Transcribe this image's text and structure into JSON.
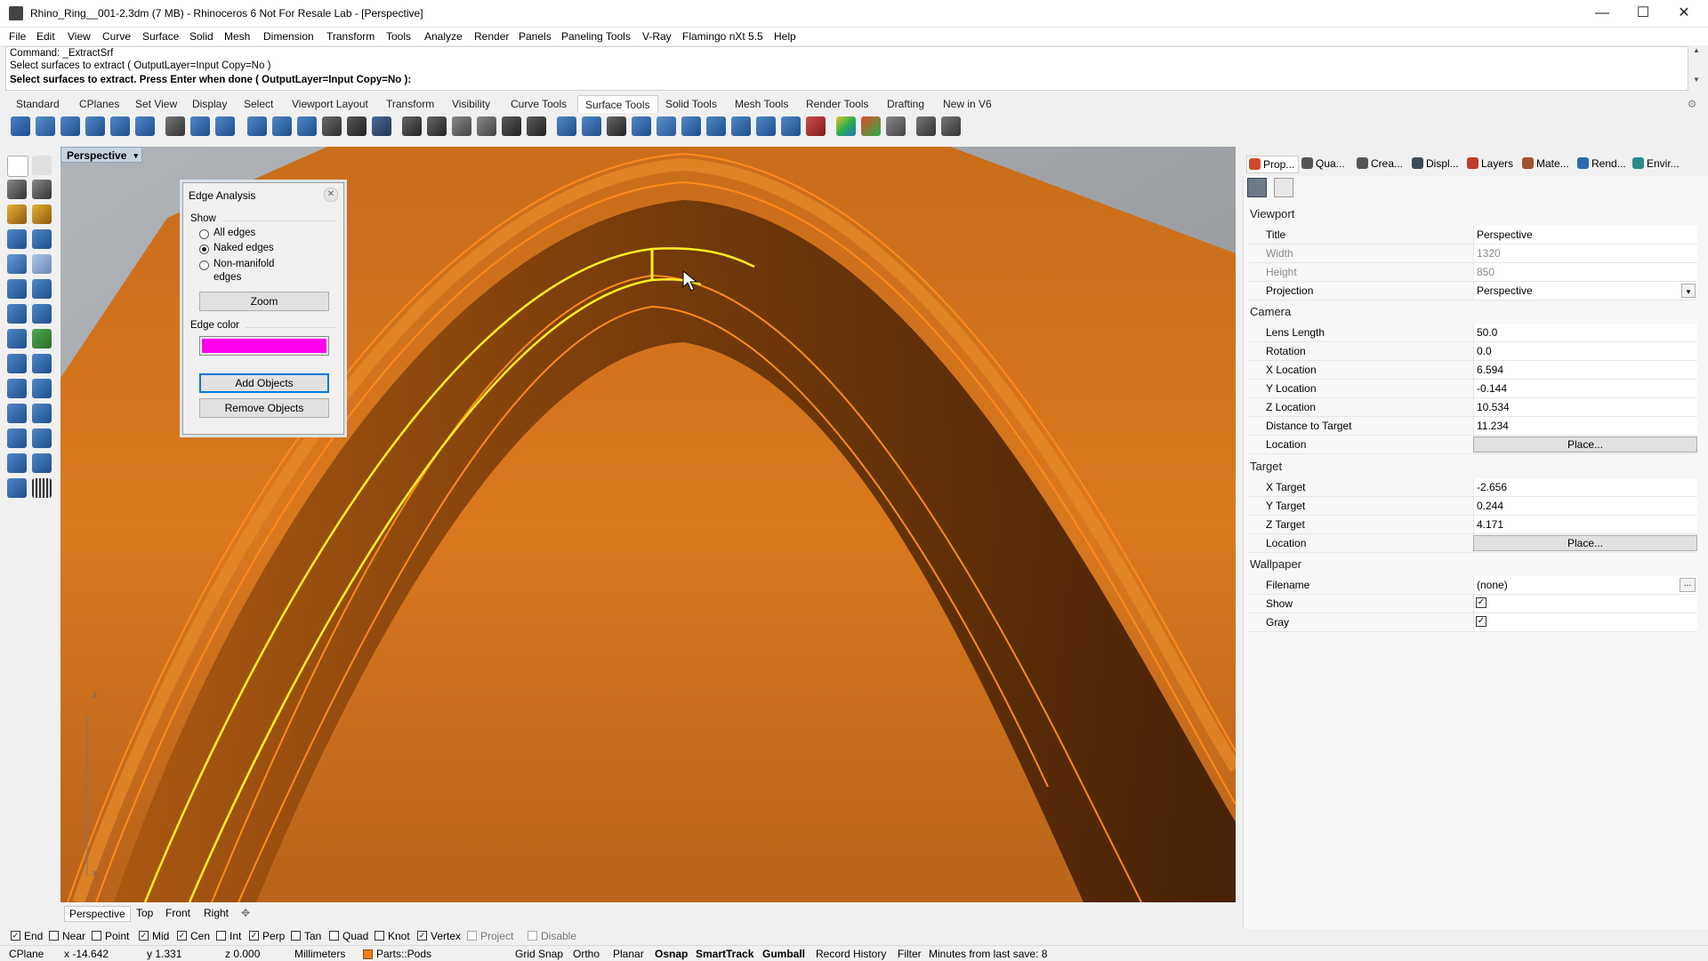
{
  "window": {
    "title": "Rhino_Ring__001-2.3dm (7 MB) - Rhinoceros 6 Not For Resale Lab - [Perspective]",
    "minimize_glyph": "—",
    "maximize_glyph": "☐",
    "close_glyph": "✕"
  },
  "menu": [
    "File",
    "Edit",
    "View",
    "Curve",
    "Surface",
    "Solid",
    "Mesh",
    "Dimension",
    "Transform",
    "Tools",
    "Analyze",
    "Render",
    "Panels",
    "Paneling Tools",
    "V-Ray",
    "Flamingo nXt 5.5",
    "Help"
  ],
  "command": {
    "line1": "Command: _ExtractSrf",
    "line2": "Select surfaces to extract ( OutputLayer=Input  Copy=No )",
    "line3": "Select surfaces to extract. Press Enter when done ( OutputLayer=Input  Copy=No ):"
  },
  "toolbar_tabs": [
    "Standard",
    "CPlanes",
    "Set View",
    "Display",
    "Select",
    "Viewport Layout",
    "Transform",
    "Visibility",
    "Curve Tools",
    "Surface Tools",
    "Solid Tools",
    "Mesh Tools",
    "Render Tools",
    "Drafting",
    "New in V6"
  ],
  "active_toolbar_tab": "Surface Tools",
  "viewport": {
    "title": "Perspective",
    "dropdown_glyph": "▾",
    "tabs": [
      "Perspective",
      "Top",
      "Front",
      "Right"
    ],
    "add_tab_glyph": "✥",
    "axis_z": "z",
    "axis_x": "x"
  },
  "edge_analysis": {
    "title": "Edge Analysis",
    "close_glyph": "✕",
    "show_label": "Show",
    "options": [
      {
        "label": "All edges",
        "selected": false
      },
      {
        "label": "Naked edges",
        "selected": true
      },
      {
        "label": "Non-manifold",
        "label2": "edges",
        "selected": false
      }
    ],
    "zoom_button": "Zoom",
    "edge_color_label": "Edge color",
    "edge_color": "#ff00ee",
    "add_objects_button": "Add Objects",
    "remove_objects_button": "Remove Objects"
  },
  "panel_tabs": [
    {
      "label": "Prop...",
      "color": "#d04a2a"
    },
    {
      "label": "Qua...",
      "color": "#555555"
    },
    {
      "label": "Crea...",
      "color": "#555555"
    },
    {
      "label": "Displ...",
      "color": "#3d4a5a"
    },
    {
      "label": "Layers",
      "color": "#c0392b"
    },
    {
      "label": "Mate...",
      "color": "#a0522d"
    },
    {
      "label": "Rend...",
      "color": "#2a6bb0"
    },
    {
      "label": "Envir...",
      "color": "#2a8a8a"
    }
  ],
  "properties": {
    "viewport_group": "Viewport",
    "title_label": "Title",
    "title_value": "Perspective",
    "width_label": "Width",
    "width_value": "1320",
    "height_label": "Height",
    "height_value": "850",
    "projection_label": "Projection",
    "projection_value": "Perspective",
    "dropdown_glyph": "▾",
    "camera_group": "Camera",
    "lens_label": "Lens Length",
    "lens_value": "50.0",
    "rotation_label": "Rotation",
    "rotation_value": "0.0",
    "xloc_label": "X Location",
    "xloc_value": "6.594",
    "yloc_label": "Y Location",
    "yloc_value": "-0.144",
    "zloc_label": "Z Location",
    "zloc_value": "10.534",
    "dist_label": "Distance to Target",
    "dist_value": "11.234",
    "cam_location_label": "Location",
    "place_button": "Place...",
    "target_group": "Target",
    "xt_label": "X Target",
    "xt_value": "-2.656",
    "yt_label": "Y Target",
    "yt_value": "0.244",
    "zt_label": "Z Target",
    "zt_value": "4.171",
    "tgt_location_label": "Location",
    "wallpaper_group": "Wallpaper",
    "filename_label": "Filename",
    "filename_value": "(none)",
    "browse_glyph": "...",
    "show_label": "Show",
    "show_checked": true,
    "gray_label": "Gray",
    "gray_checked": true,
    "check_glyph": "✓"
  },
  "osnaps": [
    {
      "label": "End",
      "checked": true
    },
    {
      "label": "Near",
      "checked": false
    },
    {
      "label": "Point",
      "checked": false
    },
    {
      "label": "Mid",
      "checked": true
    },
    {
      "label": "Cen",
      "checked": true
    },
    {
      "label": "Int",
      "checked": false
    },
    {
      "label": "Perp",
      "checked": true
    },
    {
      "label": "Tan",
      "checked": false
    },
    {
      "label": "Quad",
      "checked": false
    },
    {
      "label": "Knot",
      "checked": false
    },
    {
      "label": "Vertex",
      "checked": true
    },
    {
      "label": "Project",
      "checked": false,
      "disabled": true
    },
    {
      "label": "Disable",
      "checked": false,
      "disabled": true
    }
  ],
  "status": {
    "cplane": "CPlane",
    "x": "x -14.642",
    "y": "y 1.331",
    "z": "z 0.000",
    "units": "Millimeters",
    "layer": "Parts::Pods",
    "layer_color": "#f07d1a",
    "grid_snap": "Grid Snap",
    "ortho": "Ortho",
    "planar": "Planar",
    "osnap": "Osnap",
    "smarttrack": "SmartTrack",
    "gumball": "Gumball",
    "record_history": "Record History",
    "filter": "Filter",
    "minutes": "Minutes from last save: 8"
  },
  "colors": {
    "ring_orange": "#d9781e",
    "naked_edge_yellow": "#ffee22",
    "edge_orange": "#ff8a1a"
  }
}
